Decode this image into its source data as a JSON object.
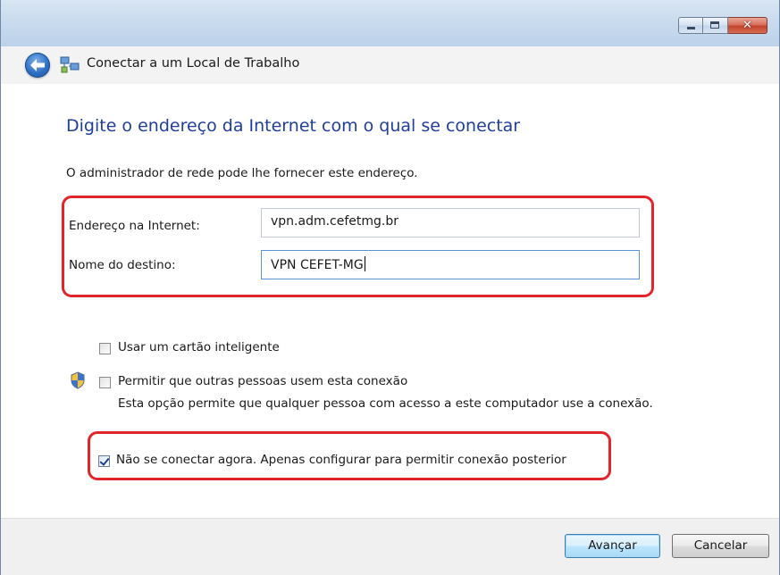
{
  "window": {
    "title": "Conectar a um Local de Trabalho",
    "caption": {
      "minimize_icon": "minimize-icon",
      "maximize_icon": "maximize-icon",
      "close_icon": "close-icon",
      "close_glyph": "✕"
    }
  },
  "page": {
    "heading": "Digite o endereço da Internet com o qual se conectar",
    "hint": "O administrador de rede pode lhe fornecer este endereço."
  },
  "fields": {
    "address_label": "Endereço na Internet:",
    "address_value": "vpn.adm.cefetmg.br",
    "name_label": "Nome do destino:",
    "name_value": "VPN CEFET-MG"
  },
  "options": {
    "smart_card": {
      "label": "Usar um cartão inteligente",
      "checked": false
    },
    "allow_others": {
      "label": "Permitir que outras pessoas usem esta conexão",
      "description": "Esta opção permite que qualquer pessoa com acesso a este computador use a conexão.",
      "checked": false
    },
    "dont_connect": {
      "label": "Não se conectar agora. Apenas configurar para permitir conexão posterior",
      "checked": true
    }
  },
  "buttons": {
    "next": "Avançar",
    "cancel": "Cancelar"
  },
  "colors": {
    "heading": "#1f3f9a",
    "highlight": "#e2242b",
    "focus_border": "#5a93d6"
  }
}
